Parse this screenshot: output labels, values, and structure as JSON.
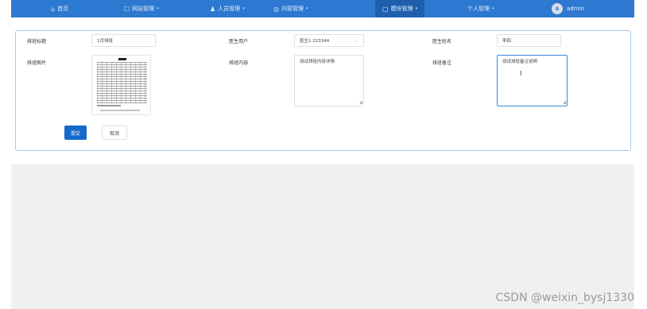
{
  "nav": {
    "items": [
      {
        "icon": "⌂",
        "label": "首页",
        "caret": ""
      },
      {
        "icon": "☐",
        "label": "网站管理",
        "caret": "▾"
      },
      {
        "icon": "♟",
        "label": "人员管理",
        "caret": "▾"
      },
      {
        "icon": "◎",
        "label": "内容管理",
        "caret": "▾"
      },
      {
        "icon": "▢",
        "label": "模块管理",
        "caret": "▾"
      },
      {
        "icon": "",
        "label": "个人管理",
        "caret": "▾"
      }
    ],
    "avatar_glyph": "A",
    "user": "admin"
  },
  "form": {
    "title_label": "排班标题",
    "title_value": "1月排班",
    "doctor_account_label": "医生用户",
    "doctor_account_value": "医生1 223344",
    "doctor_name_label": "医生姓名",
    "doctor_name_value": "李四",
    "image_label": "排班图片",
    "content_label": "排班内容",
    "content_value": "测试排班内容详情",
    "remark_label": "排班备注",
    "remark_value": "测试排班备注说明",
    "submit_label": "提交",
    "cancel_label": "取消"
  },
  "watermark": "CSDN @weixin_bysj1330"
}
